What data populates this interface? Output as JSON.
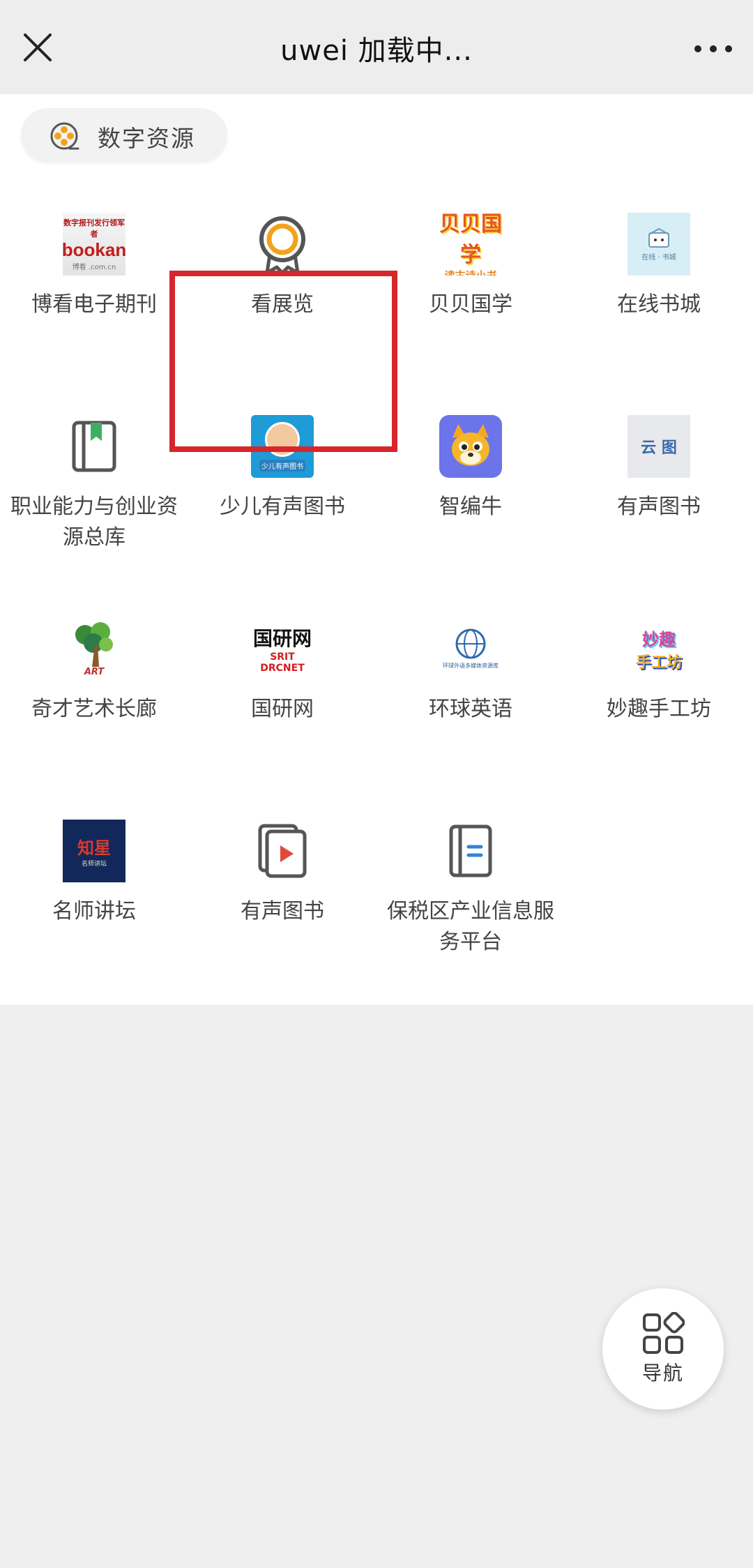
{
  "header": {
    "title": "uwei 加载中..."
  },
  "section": {
    "label": "数字资源"
  },
  "grid": {
    "items": [
      {
        "label": "博看电子期刊",
        "thumb_title": "数字报刊发行领军者",
        "thumb_brand": "bookan",
        "thumb_sub": "博看 .com.cn"
      },
      {
        "label": "看展览"
      },
      {
        "label": "贝贝国学",
        "thumb_title": "贝贝国学",
        "thumb_sub": "读古诗小书"
      },
      {
        "label": "在线书城",
        "thumb_sub": "在线 · 书城"
      },
      {
        "label": "职业能力与创业资源总库"
      },
      {
        "label": "少儿有声图书",
        "thumb_sub": "少儿有声图书"
      },
      {
        "label": "智编牛"
      },
      {
        "label": "有声图书",
        "thumb_title": "云 图"
      },
      {
        "label": "奇才艺术长廊",
        "thumb_sub": "ART"
      },
      {
        "label": "国研网",
        "thumb_title": "国研网",
        "thumb_sub": "SRIT DRCNET"
      },
      {
        "label": "环球英语",
        "thumb_sub": "环球外语多媒体资源库"
      },
      {
        "label": "妙趣手工坊",
        "thumb_title": "妙趣",
        "thumb_sub": "手工坊"
      },
      {
        "label": "名师讲坛",
        "thumb_title": "知星",
        "thumb_sub": "名师讲坛"
      },
      {
        "label": "有声图书"
      },
      {
        "label": "保税区产业信息服务平台"
      }
    ]
  },
  "nav": {
    "label": "导航"
  },
  "colors": {
    "highlight": "#d7262b",
    "medal_ring": "#f3a21b"
  },
  "icons": [
    "close-icon",
    "more-icon",
    "film-reel-icon",
    "medal-icon",
    "book-icon",
    "play-book-icon",
    "document-icon",
    "grid-nav-icon"
  ]
}
